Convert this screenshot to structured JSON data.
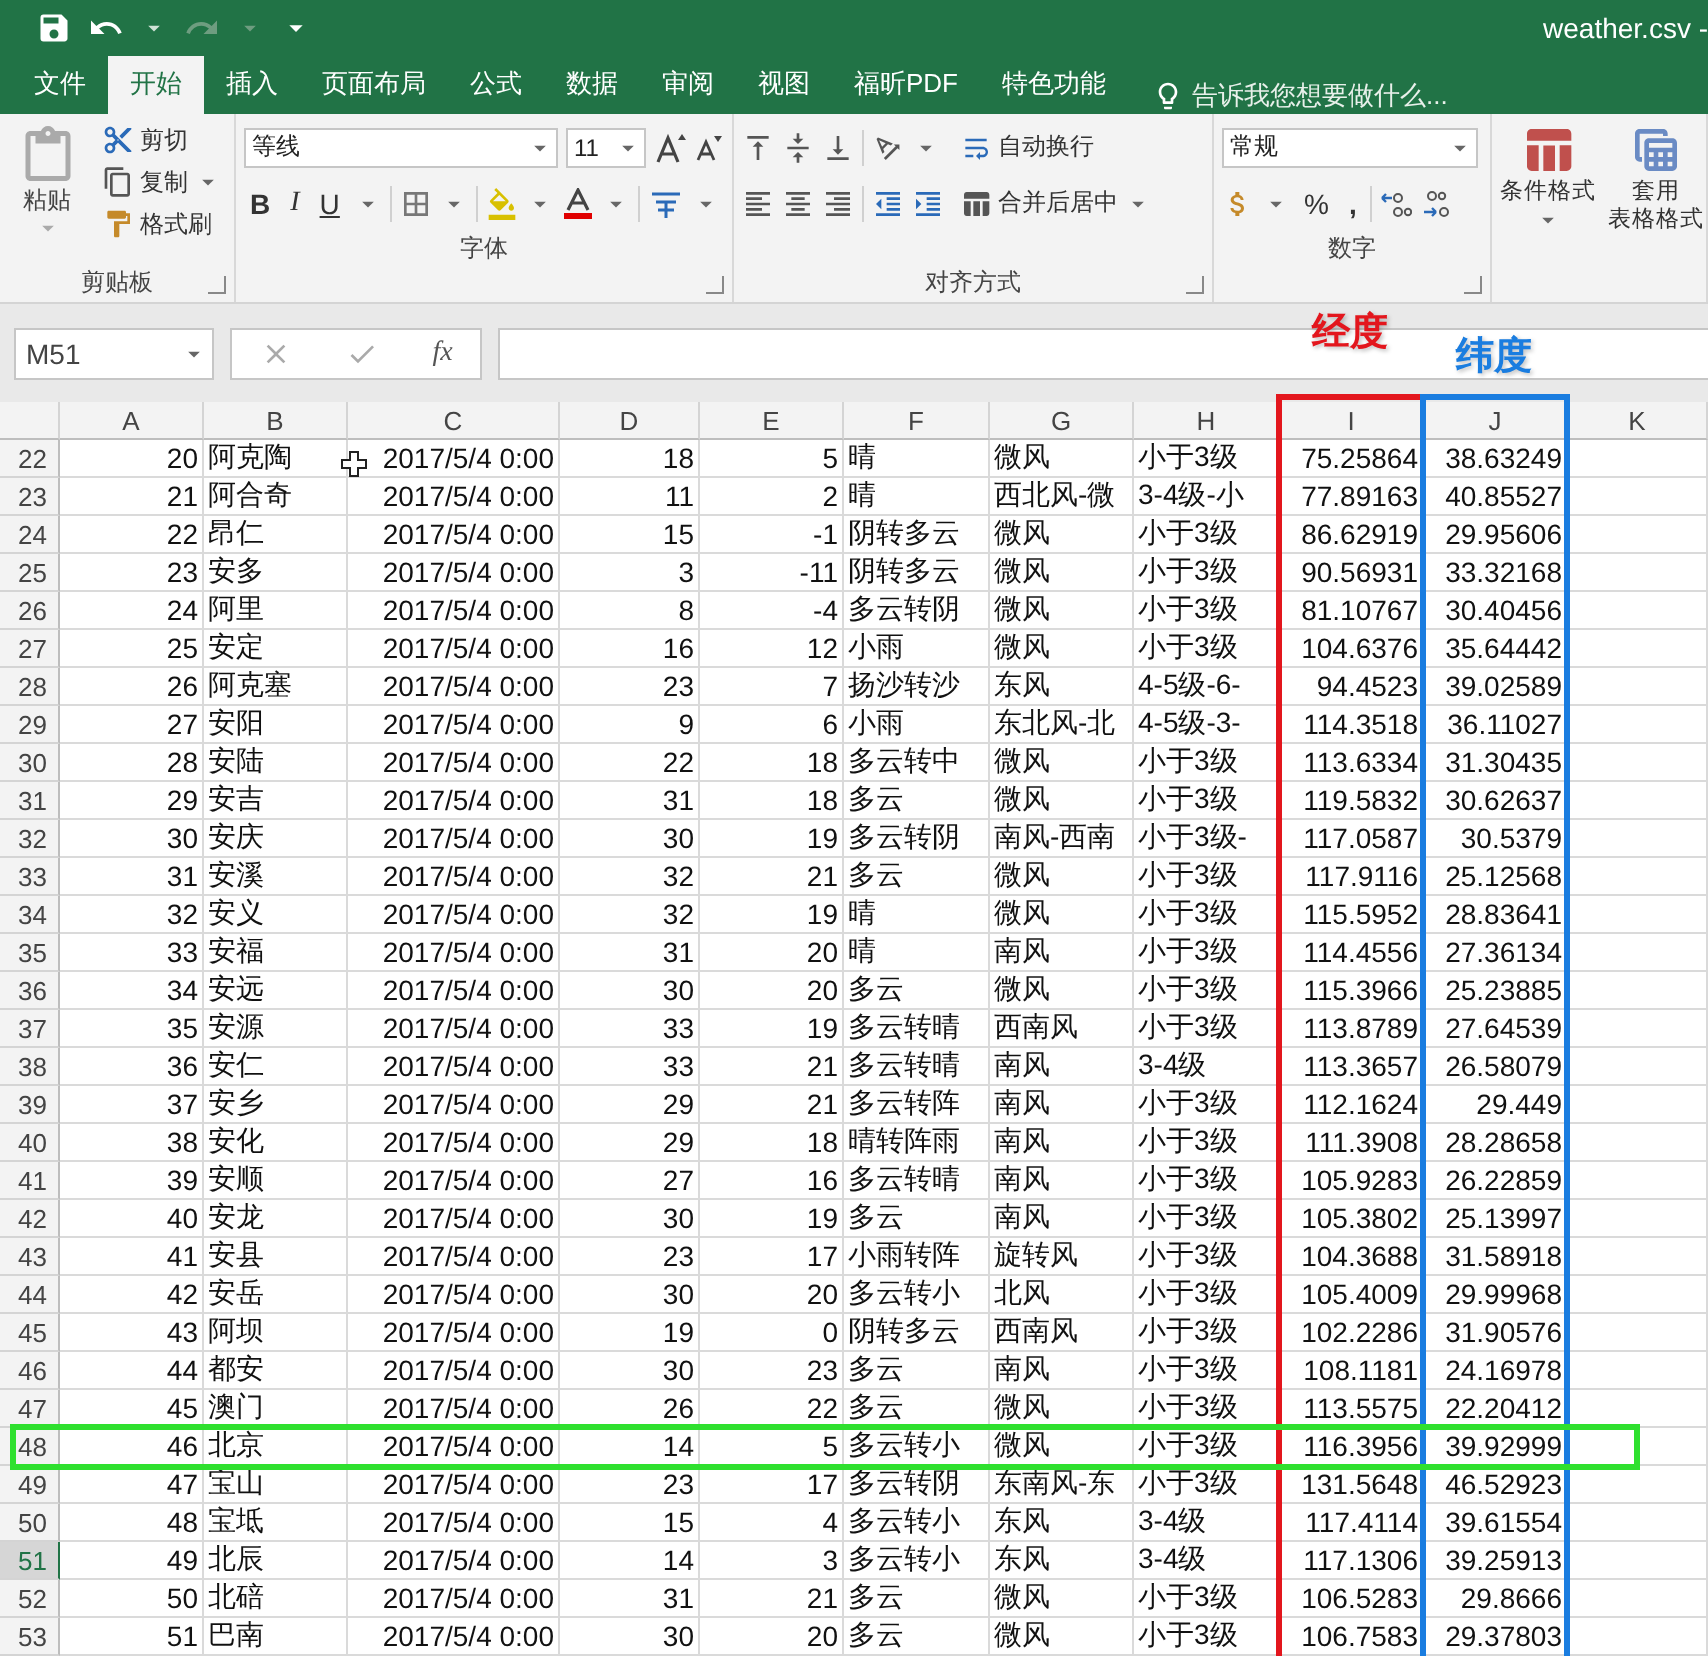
{
  "title": "weather.csv -",
  "tabs": [
    {
      "label": "文件",
      "selected": false
    },
    {
      "label": "开始",
      "selected": true
    },
    {
      "label": "插入",
      "selected": false
    },
    {
      "label": "页面布局",
      "selected": false
    },
    {
      "label": "公式",
      "selected": false
    },
    {
      "label": "数据",
      "selected": false
    },
    {
      "label": "审阅",
      "selected": false
    },
    {
      "label": "视图",
      "selected": false
    },
    {
      "label": "福昕PDF",
      "selected": false
    },
    {
      "label": "特色功能",
      "selected": false
    }
  ],
  "tell_me": "告诉我您想要做什么...",
  "ribbon": {
    "clipboard": {
      "paste": "粘贴",
      "cut": "剪切",
      "copy": "复制",
      "format_painter": "格式刷",
      "label": "剪贴板"
    },
    "font": {
      "name": "等线",
      "size": "11",
      "bold": "B",
      "italic": "I",
      "underline": "U",
      "label": "字体"
    },
    "alignment": {
      "wrap_text": "自动换行",
      "merge_center": "合并后居中",
      "label": "对齐方式"
    },
    "number": {
      "format": "常规",
      "percent": "%",
      "comma": ",",
      "label": "数字"
    },
    "styles": {
      "conditional_format": "条件格式",
      "format_as_table": "套用",
      "format_as_table_2": "表格格式"
    }
  },
  "name_box": "M51",
  "formula_button": "fx",
  "columns": [
    {
      "label": "A",
      "kind": "number"
    },
    {
      "label": "B",
      "kind": "text"
    },
    {
      "label": "C",
      "kind": "number"
    },
    {
      "label": "D",
      "kind": "number"
    },
    {
      "label": "E",
      "kind": "number"
    },
    {
      "label": "F",
      "kind": "text"
    },
    {
      "label": "G",
      "kind": "text"
    },
    {
      "label": "H",
      "kind": "text"
    },
    {
      "label": "I",
      "kind": "number",
      "color": "#e3161d",
      "note": "经度"
    },
    {
      "label": "J",
      "kind": "number",
      "color": "#1a7de0",
      "note": "纬度"
    },
    {
      "label": "K"
    }
  ],
  "rows": [
    {
      "header": "22",
      "selected": false,
      "cells": [
        "20",
        "阿克陶",
        "2017/5/4 0:00",
        "18",
        "5",
        "晴",
        "微风",
        "小于3级",
        "75.25864",
        "38.63249"
      ]
    },
    {
      "header": "23",
      "selected": false,
      "cells": [
        "21",
        "阿合奇",
        "2017/5/4 0:00",
        "11",
        "2",
        "晴",
        "西北风-微",
        "3-4级-小",
        "77.89163",
        "40.85527"
      ]
    },
    {
      "header": "24",
      "selected": false,
      "cells": [
        "22",
        "昂仁",
        "2017/5/4 0:00",
        "15",
        "-1",
        "阴转多云",
        "微风",
        "小于3级",
        "86.62919",
        "29.95606"
      ]
    },
    {
      "header": "25",
      "selected": false,
      "cells": [
        "23",
        "安多",
        "2017/5/4 0:00",
        "3",
        "-11",
        "阴转多云",
        "微风",
        "小于3级",
        "90.56931",
        "33.32168"
      ]
    },
    {
      "header": "26",
      "selected": false,
      "cells": [
        "24",
        "阿里",
        "2017/5/4 0:00",
        "8",
        "-4",
        "多云转阴",
        "微风",
        "小于3级",
        "81.10767",
        "30.40456"
      ]
    },
    {
      "header": "27",
      "selected": false,
      "cells": [
        "25",
        "安定",
        "2017/5/4 0:00",
        "16",
        "12",
        "小雨",
        "微风",
        "小于3级",
        "104.6376",
        "35.64442"
      ]
    },
    {
      "header": "28",
      "selected": false,
      "cells": [
        "26",
        "阿克塞",
        "2017/5/4 0:00",
        "23",
        "7",
        "扬沙转沙",
        "东风",
        "4-5级-6-",
        "94.4523",
        "39.02589"
      ]
    },
    {
      "header": "29",
      "selected": false,
      "cells": [
        "27",
        "安阳",
        "2017/5/4 0:00",
        "9",
        "6",
        "小雨",
        "东北风-北",
        "4-5级-3-",
        "114.3518",
        "36.11027"
      ]
    },
    {
      "header": "30",
      "selected": false,
      "cells": [
        "28",
        "安陆",
        "2017/5/4 0:00",
        "22",
        "18",
        "多云转中",
        "微风",
        "小于3级",
        "113.6334",
        "31.30435"
      ]
    },
    {
      "header": "31",
      "selected": false,
      "cells": [
        "29",
        "安吉",
        "2017/5/4 0:00",
        "31",
        "18",
        "多云",
        "微风",
        "小于3级",
        "119.5832",
        "30.62637"
      ]
    },
    {
      "header": "32",
      "selected": false,
      "cells": [
        "30",
        "安庆",
        "2017/5/4 0:00",
        "30",
        "19",
        "多云转阴",
        "南风-西南",
        "小于3级-",
        "117.0587",
        "30.5379"
      ]
    },
    {
      "header": "33",
      "selected": false,
      "cells": [
        "31",
        "安溪",
        "2017/5/4 0:00",
        "32",
        "21",
        "多云",
        "微风",
        "小于3级",
        "117.9116",
        "25.12568"
      ]
    },
    {
      "header": "34",
      "selected": false,
      "cells": [
        "32",
        "安义",
        "2017/5/4 0:00",
        "32",
        "19",
        "晴",
        "微风",
        "小于3级",
        "115.5952",
        "28.83641"
      ]
    },
    {
      "header": "35",
      "selected": false,
      "cells": [
        "33",
        "安福",
        "2017/5/4 0:00",
        "31",
        "20",
        "晴",
        "南风",
        "小于3级",
        "114.4556",
        "27.36134"
      ]
    },
    {
      "header": "36",
      "selected": false,
      "cells": [
        "34",
        "安远",
        "2017/5/4 0:00",
        "30",
        "20",
        "多云",
        "微风",
        "小于3级",
        "115.3966",
        "25.23885"
      ]
    },
    {
      "header": "37",
      "selected": false,
      "cells": [
        "35",
        "安源",
        "2017/5/4 0:00",
        "33",
        "19",
        "多云转晴",
        "西南风",
        "小于3级",
        "113.8789",
        "27.64539"
      ]
    },
    {
      "header": "38",
      "selected": false,
      "cells": [
        "36",
        "安仁",
        "2017/5/4 0:00",
        "33",
        "21",
        "多云转晴",
        "南风",
        "3-4级",
        "113.3657",
        "26.58079"
      ]
    },
    {
      "header": "39",
      "selected": false,
      "cells": [
        "37",
        "安乡",
        "2017/5/4 0:00",
        "29",
        "21",
        "多云转阵",
        "南风",
        "小于3级",
        "112.1624",
        "29.449"
      ]
    },
    {
      "header": "40",
      "selected": false,
      "cells": [
        "38",
        "安化",
        "2017/5/4 0:00",
        "29",
        "18",
        "晴转阵雨",
        "南风",
        "小于3级",
        "111.3908",
        "28.28658"
      ]
    },
    {
      "header": "41",
      "selected": false,
      "cells": [
        "39",
        "安顺",
        "2017/5/4 0:00",
        "27",
        "16",
        "多云转晴",
        "南风",
        "小于3级",
        "105.9283",
        "26.22859"
      ]
    },
    {
      "header": "42",
      "selected": false,
      "cells": [
        "40",
        "安龙",
        "2017/5/4 0:00",
        "30",
        "19",
        "多云",
        "南风",
        "小于3级",
        "105.3802",
        "25.13997"
      ]
    },
    {
      "header": "43",
      "selected": false,
      "cells": [
        "41",
        "安县",
        "2017/5/4 0:00",
        "23",
        "17",
        "小雨转阵",
        "旋转风",
        "小于3级",
        "104.3688",
        "31.58918"
      ]
    },
    {
      "header": "44",
      "selected": false,
      "cells": [
        "42",
        "安岳",
        "2017/5/4 0:00",
        "30",
        "20",
        "多云转小",
        "北风",
        "小于3级",
        "105.4009",
        "29.99968"
      ]
    },
    {
      "header": "45",
      "selected": false,
      "cells": [
        "43",
        "阿坝",
        "2017/5/4 0:00",
        "19",
        "0",
        "阴转多云",
        "西南风",
        "小于3级",
        "102.2286",
        "31.90576"
      ]
    },
    {
      "header": "46",
      "selected": false,
      "cells": [
        "44",
        "都安",
        "2017/5/4 0:00",
        "30",
        "23",
        "多云",
        "南风",
        "小于3级",
        "108.1181",
        "24.16978"
      ]
    },
    {
      "header": "47",
      "selected": false,
      "cells": [
        "45",
        "澳门",
        "2017/5/4 0:00",
        "26",
        "22",
        "多云",
        "微风",
        "小于3级",
        "113.5575",
        "22.20412"
      ]
    },
    {
      "header": "48",
      "selected": false,
      "color": "#2fe02f",
      "cells": [
        "46",
        "北京",
        "2017/5/4 0:00",
        "14",
        "5",
        "多云转小",
        "微风",
        "小于3级",
        "116.3956",
        "39.92999"
      ]
    },
    {
      "header": "49",
      "selected": false,
      "cells": [
        "47",
        "宝山",
        "2017/5/4 0:00",
        "23",
        "17",
        "多云转阴",
        "东南风-东",
        "小于3级",
        "131.5648",
        "46.52923"
      ]
    },
    {
      "header": "50",
      "selected": false,
      "cells": [
        "48",
        "宝坻",
        "2017/5/4 0:00",
        "15",
        "4",
        "多云转小",
        "东风",
        "3-4级",
        "117.4114",
        "39.61554"
      ]
    },
    {
      "header": "51",
      "selected": true,
      "cells": [
        "49",
        "北辰",
        "2017/5/4 0:00",
        "14",
        "3",
        "多云转小",
        "东风",
        "3-4级",
        "117.1306",
        "39.25913"
      ]
    },
    {
      "header": "52",
      "selected": false,
      "cells": [
        "50",
        "北碚",
        "2017/5/4 0:00",
        "31",
        "21",
        "多云",
        "微风",
        "小于3级",
        "106.5283",
        "29.8666"
      ]
    },
    {
      "header": "53",
      "selected": false,
      "cells": [
        "51",
        "巴南",
        "2017/5/4 0:00",
        "30",
        "20",
        "多云",
        "微风",
        "小于3级",
        "106.7583",
        "29.37803"
      ]
    }
  ]
}
